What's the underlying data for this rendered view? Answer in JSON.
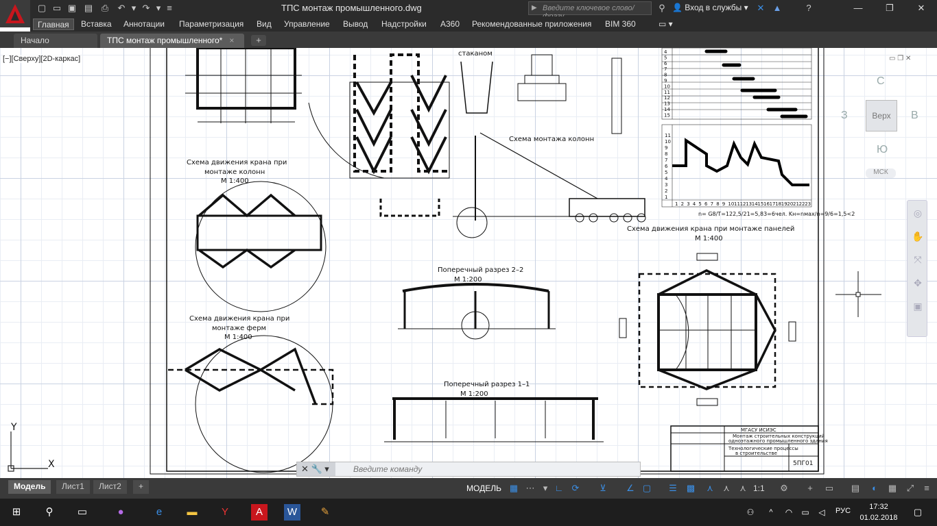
{
  "titlebar": {
    "window_title": "ТПС монтаж промышленного.dwg",
    "search_placeholder": "Введите ключевое слово/фразу",
    "signin_label": "Вход в службы",
    "minimize": "—",
    "maximize": "❐",
    "close": "✕"
  },
  "ribbon": {
    "tabs": [
      "Главная",
      "Вставка",
      "Аннотации",
      "Параметризация",
      "Вид",
      "Управление",
      "Вывод",
      "Надстройки",
      "A360",
      "Рекомендованные приложения",
      "BIM 360"
    ],
    "active_tab": "Главная"
  },
  "file_tabs": {
    "start": "Начало",
    "current": "ТПС монтаж промышленного*",
    "close": "×",
    "new": "+"
  },
  "viewport": {
    "label": "[−][Сверху][2D-каркас]"
  },
  "viewcube": {
    "north": "С",
    "south": "Ю",
    "west": "З",
    "east": "В",
    "top_face": "Верх",
    "wcs": "МСК"
  },
  "drawing": {
    "glass_label": "стаканом",
    "col_scheme_title": "Схема монтажа колонн",
    "crane_cols_title_1": "Схема движения крана при",
    "crane_cols_title_2": "монтаже колонн",
    "crane_cols_scale": "М 1:400",
    "crane_panels_title": "Схема движения крана при монтаже панелей",
    "crane_panels_scale": "М 1:400",
    "section22_title": "Поперечный разрез 2–2",
    "section22_scale": "М 1:200",
    "crane_truss_title_1": "Схема движения крана при",
    "crane_truss_title_2": "монтаже ферм",
    "crane_truss_scale": "М 1:400",
    "section11_title": "Поперечный разрез 1–1",
    "section11_scale": "М 1:200",
    "formula": "n= G8/T=122,5/21=5,83=6чел. Kн=nмах/n=9/6=1,5<2",
    "stamp_org": "МГАСУ ИСИЭС",
    "stamp_line1": "Монтаж строительных конструкций",
    "stamp_line2": "одноэтажного промышленного здания",
    "stamp_line3": "Технологические процессы",
    "stamp_line4": "в строительстве",
    "stamp_code": "5ПГ01",
    "chart_rows": [
      "4",
      "5",
      "6",
      "7",
      "8",
      "9",
      "10",
      "11",
      "12",
      "13",
      "14",
      "15"
    ],
    "chart_y": [
      "11",
      "10",
      "9",
      "8",
      "7",
      "6",
      "5",
      "4",
      "3",
      "2",
      "1"
    ],
    "chart_x": [
      "1",
      "2",
      "3",
      "4",
      "5",
      "6",
      "7",
      "8",
      "9",
      "10",
      "11",
      "12",
      "13",
      "14",
      "15",
      "16",
      "17",
      "18",
      "19",
      "20",
      "21",
      "22",
      "23"
    ]
  },
  "axes": {
    "y": "Y",
    "x": "X"
  },
  "cmdline": {
    "placeholder": "Введите команду"
  },
  "layout_tabs": {
    "model": "Модель",
    "sheet1": "Лист1",
    "sheet2": "Лист2",
    "add": "+"
  },
  "statusbar": {
    "model_button": "МОДЕЛЬ",
    "scale": "1:1"
  },
  "taskbar": {
    "lang": "РУС",
    "time": "17:32",
    "date": "01.02.2018"
  },
  "colors": {
    "accent": "#3b8fe6",
    "logo_red": "#c8161d",
    "ribbon_bg": "#2b2b2b"
  }
}
